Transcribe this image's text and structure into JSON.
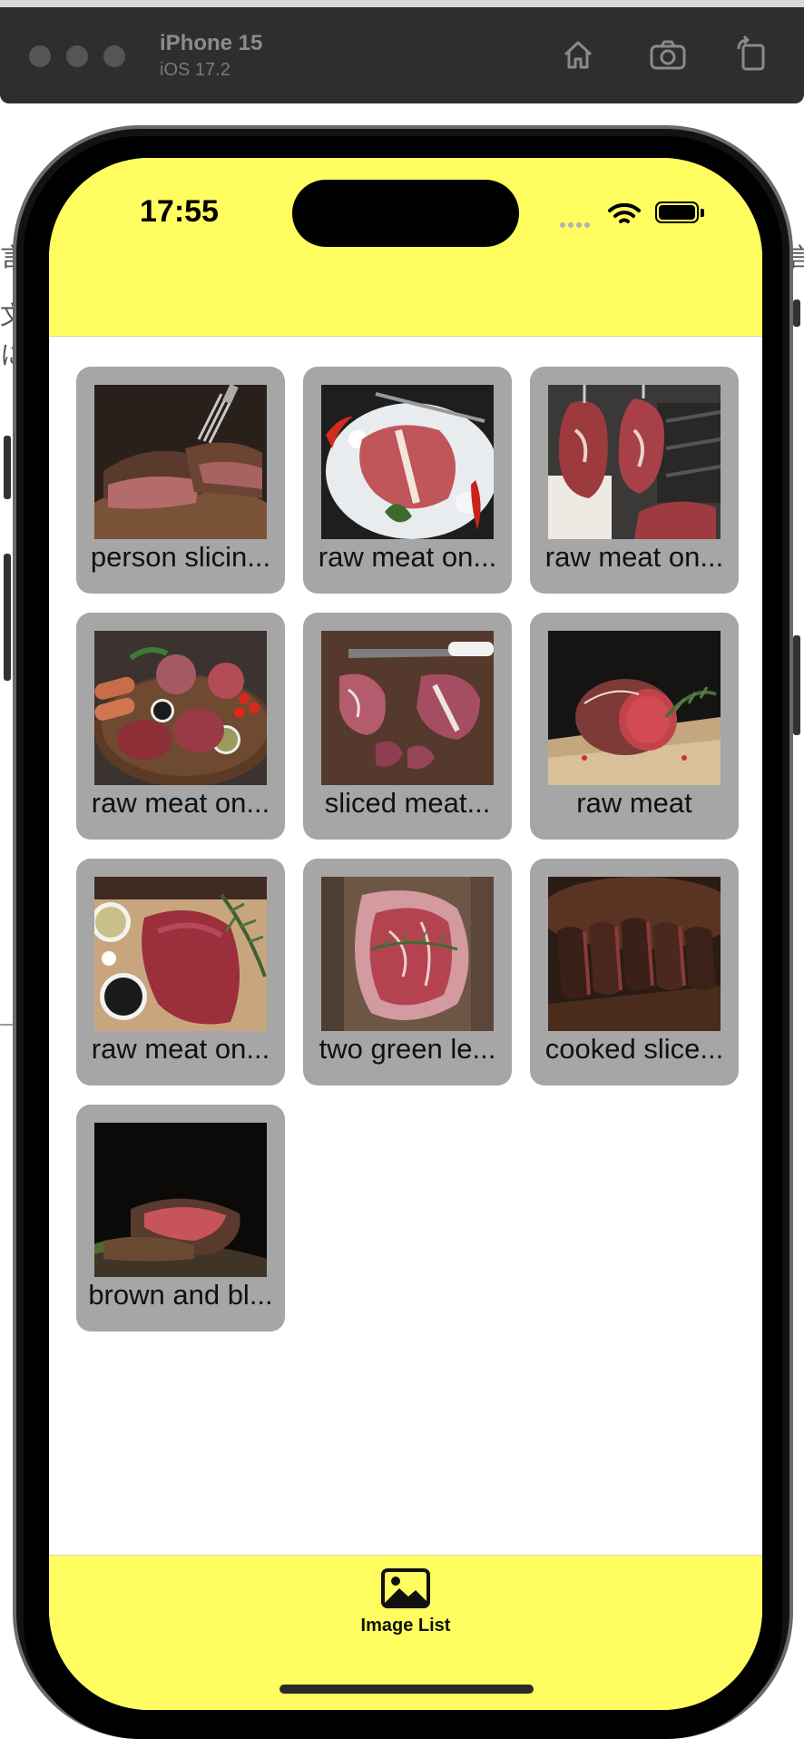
{
  "simulator": {
    "device_name": "iPhone 15",
    "os_version": "iOS 17.2",
    "icons": [
      "home-icon",
      "screenshot-camera-icon",
      "rotate-icon"
    ]
  },
  "status_bar": {
    "time": "17:55"
  },
  "images": [
    {
      "caption": "person slicin...",
      "thumb": "steak-slicing"
    },
    {
      "caption": "raw meat on...",
      "thumb": "t-bone-ice"
    },
    {
      "caption": "raw meat on...",
      "thumb": "hanging-ribeye"
    },
    {
      "caption": "raw meat on...",
      "thumb": "meat-platter"
    },
    {
      "caption": "sliced meat...",
      "thumb": "board-knife"
    },
    {
      "caption": "raw meat",
      "thumb": "roast-rosemary"
    },
    {
      "caption": "raw meat on...",
      "thumb": "steak-peppercorns"
    },
    {
      "caption": "two green le...",
      "thumb": "ribeye-wood"
    },
    {
      "caption": "cooked slice...",
      "thumb": "grilled-slices"
    },
    {
      "caption": "brown and bl...",
      "thumb": "seared-steak"
    }
  ],
  "tab_bar": {
    "items": [
      {
        "label": "Image List",
        "icon": "photo-icon",
        "selected": true
      }
    ]
  },
  "colors": {
    "nav_yellow": "#fffd5f",
    "card_gray": "#a6a6a6"
  }
}
